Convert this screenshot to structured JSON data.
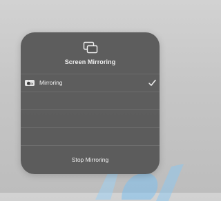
{
  "panel": {
    "title": "Screen Mirroring",
    "icon": "screen-mirroring-icon"
  },
  "devices": [
    {
      "label": "Mirroring",
      "icon": "apple-tv-icon",
      "selected": true,
      "check_icon": "checkmark-icon"
    }
  ],
  "footer": {
    "stop_label": "Stop Mirroring"
  },
  "colors": {
    "panel_bg": "#545454",
    "text": "#f2f2f2",
    "backdrop": "#c8c8c8",
    "watermark": "#6fb8ec"
  }
}
